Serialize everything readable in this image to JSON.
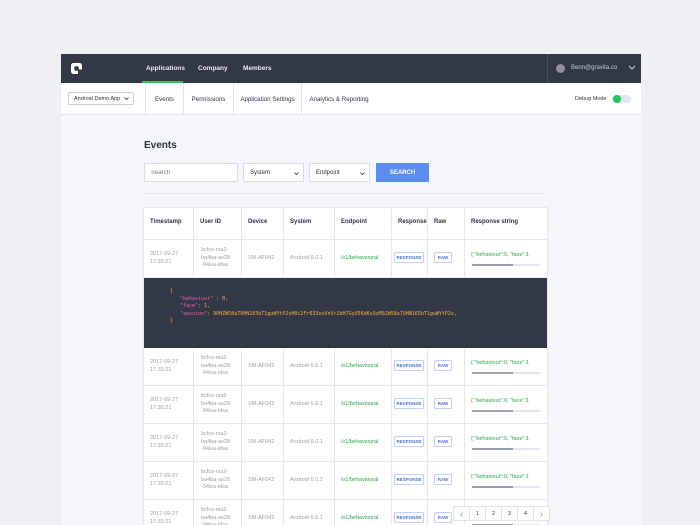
{
  "topnav": {
    "items": [
      "Applications",
      "Company",
      "Members"
    ],
    "user_email": "Benn@gravita.co"
  },
  "subnav": {
    "app_select": "Android Demo App",
    "tabs": [
      "Events",
      "Permissions",
      "Application Settings",
      "Analytics & Reporting"
    ],
    "debug_label": "Debug Mode",
    "debug_on": true
  },
  "page": {
    "title": "Events"
  },
  "filters": {
    "search_placeholder": "Search",
    "system_value": "System",
    "endpoint_value": "Endpoint",
    "search_button": "SEARCH"
  },
  "table": {
    "headers": [
      "Timestamp",
      "User ID",
      "Device",
      "System",
      "Endpoint",
      "Response",
      "Raw",
      "Response string"
    ],
    "response_button": "RESPONSE",
    "raw_button": "RAW",
    "rows": [
      {
        "date": "2017-09-27",
        "time": "17:35:21",
        "uid1": "bcfcs-rsa2-",
        "uid2": "ba4ba-as28",
        "uid3": "-94isa-idsa",
        "device": "SM-AF042",
        "system": "Android 6.0.1",
        "endpoint": "/v1/behavioural",
        "response_string": "{ \"behaviour\":0, \"face\":1",
        "bar": 0.6
      },
      {
        "date": "2017-09-27",
        "time": "17:35:21",
        "uid1": "bcfcs-rsa2-",
        "uid2": "ba4ba-as28",
        "uid3": "-94isa-idsa",
        "device": "SM-AF042",
        "system": "Android 6.0.1",
        "endpoint": "/v1/behavioural",
        "response_string": "{ \"behaviour\":0, \"face\":1",
        "bar": 0.6
      },
      {
        "date": "2017-09-27",
        "time": "17:35:21",
        "uid1": "bcfcs-rsa2-",
        "uid2": "ba4ba-as28",
        "uid3": "-94isa-idsa",
        "device": "SM-AF042",
        "system": "Android 6.0.1",
        "endpoint": "/v1/behavioural",
        "response_string": "{ \"behaviour\":0, \"face\":1",
        "bar": 0.6
      },
      {
        "date": "2017-09-27",
        "time": "17:35:21",
        "uid1": "bcfcs-rsa2-",
        "uid2": "ba4ba-as28",
        "uid3": "-94isa-idsa",
        "device": "SM-AF042",
        "system": "Android 6.0.1",
        "endpoint": "/v1/behavioural",
        "response_string": "{ \"behaviour\":0, \"face\":1",
        "bar": 0.6
      },
      {
        "date": "2017-09-27",
        "time": "17:35:21",
        "uid1": "bcfcs-rsa2-",
        "uid2": "ba4ba-as28",
        "uid3": "-94isa-idsa",
        "device": "SM-AF042",
        "system": "Android 6.0.1",
        "endpoint": "/v1/behavioural",
        "response_string": "{ \"behaviour\":0, \"face\":1",
        "bar": 0.6
      },
      {
        "date": "2017-09-27",
        "time": "17:35:21",
        "uid1": "bcfcs-rsa2-",
        "uid2": "ba4ba-as28",
        "uid3": "-94isa-idsa",
        "device": "SM-AF042",
        "system": "Android 6.0.1",
        "endpoint": "/v1/behavioural",
        "response_string": "{ \"behaviour\":0, \"face\":1",
        "bar": 0.6
      }
    ],
    "raw_json": {
      "open": "{",
      "key1": "\"behaviour\"",
      "val1": " : 0,",
      "key2": "\"face\"",
      "val2": ": 1,",
      "key3": "\"session\"",
      "val3": ": 9PHZW58a7UHN165bT1guWYtP2vH0i2Fr633osVnVr2bH7GyU5KdKxQzM02W58a7UHN165bT1guWYtP2v,",
      "close": "}"
    }
  },
  "pagination": {
    "pages": [
      "1",
      "2",
      "3",
      "4"
    ]
  },
  "colors": {
    "topbar": "#323846",
    "accent_green": "#22c55e",
    "primary_blue": "#5b8def",
    "code_bg": "#323846"
  }
}
